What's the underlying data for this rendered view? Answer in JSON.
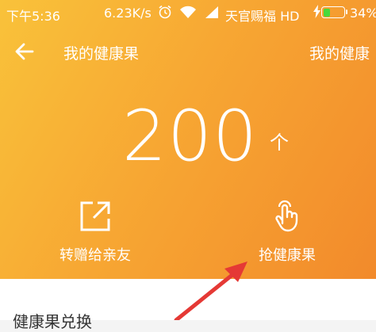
{
  "status_bar": {
    "time": "下午5:36",
    "speed": "6.23K/s",
    "carrier": "天官赐福 HD",
    "battery_percent": "34%",
    "battery_level": 0.34,
    "icons": [
      "alarm-icon",
      "wifi-icon",
      "signal-icon",
      "charging-icon",
      "battery-icon"
    ]
  },
  "header": {
    "title": "我的健康果",
    "right_link": "我的健康"
  },
  "balance": {
    "count": "200",
    "unit": "个"
  },
  "actions": [
    {
      "label": "转赠给亲友",
      "icon": "share-icon"
    },
    {
      "label": "抢健康果",
      "icon": "tap-hand-icon"
    }
  ],
  "section": {
    "title": "健康果兑换"
  },
  "colors": {
    "gradient_start": "#f9c23a",
    "gradient_end": "#f28a2b",
    "annotation_arrow": "#e53935",
    "battery_fill": "#47d93c"
  }
}
